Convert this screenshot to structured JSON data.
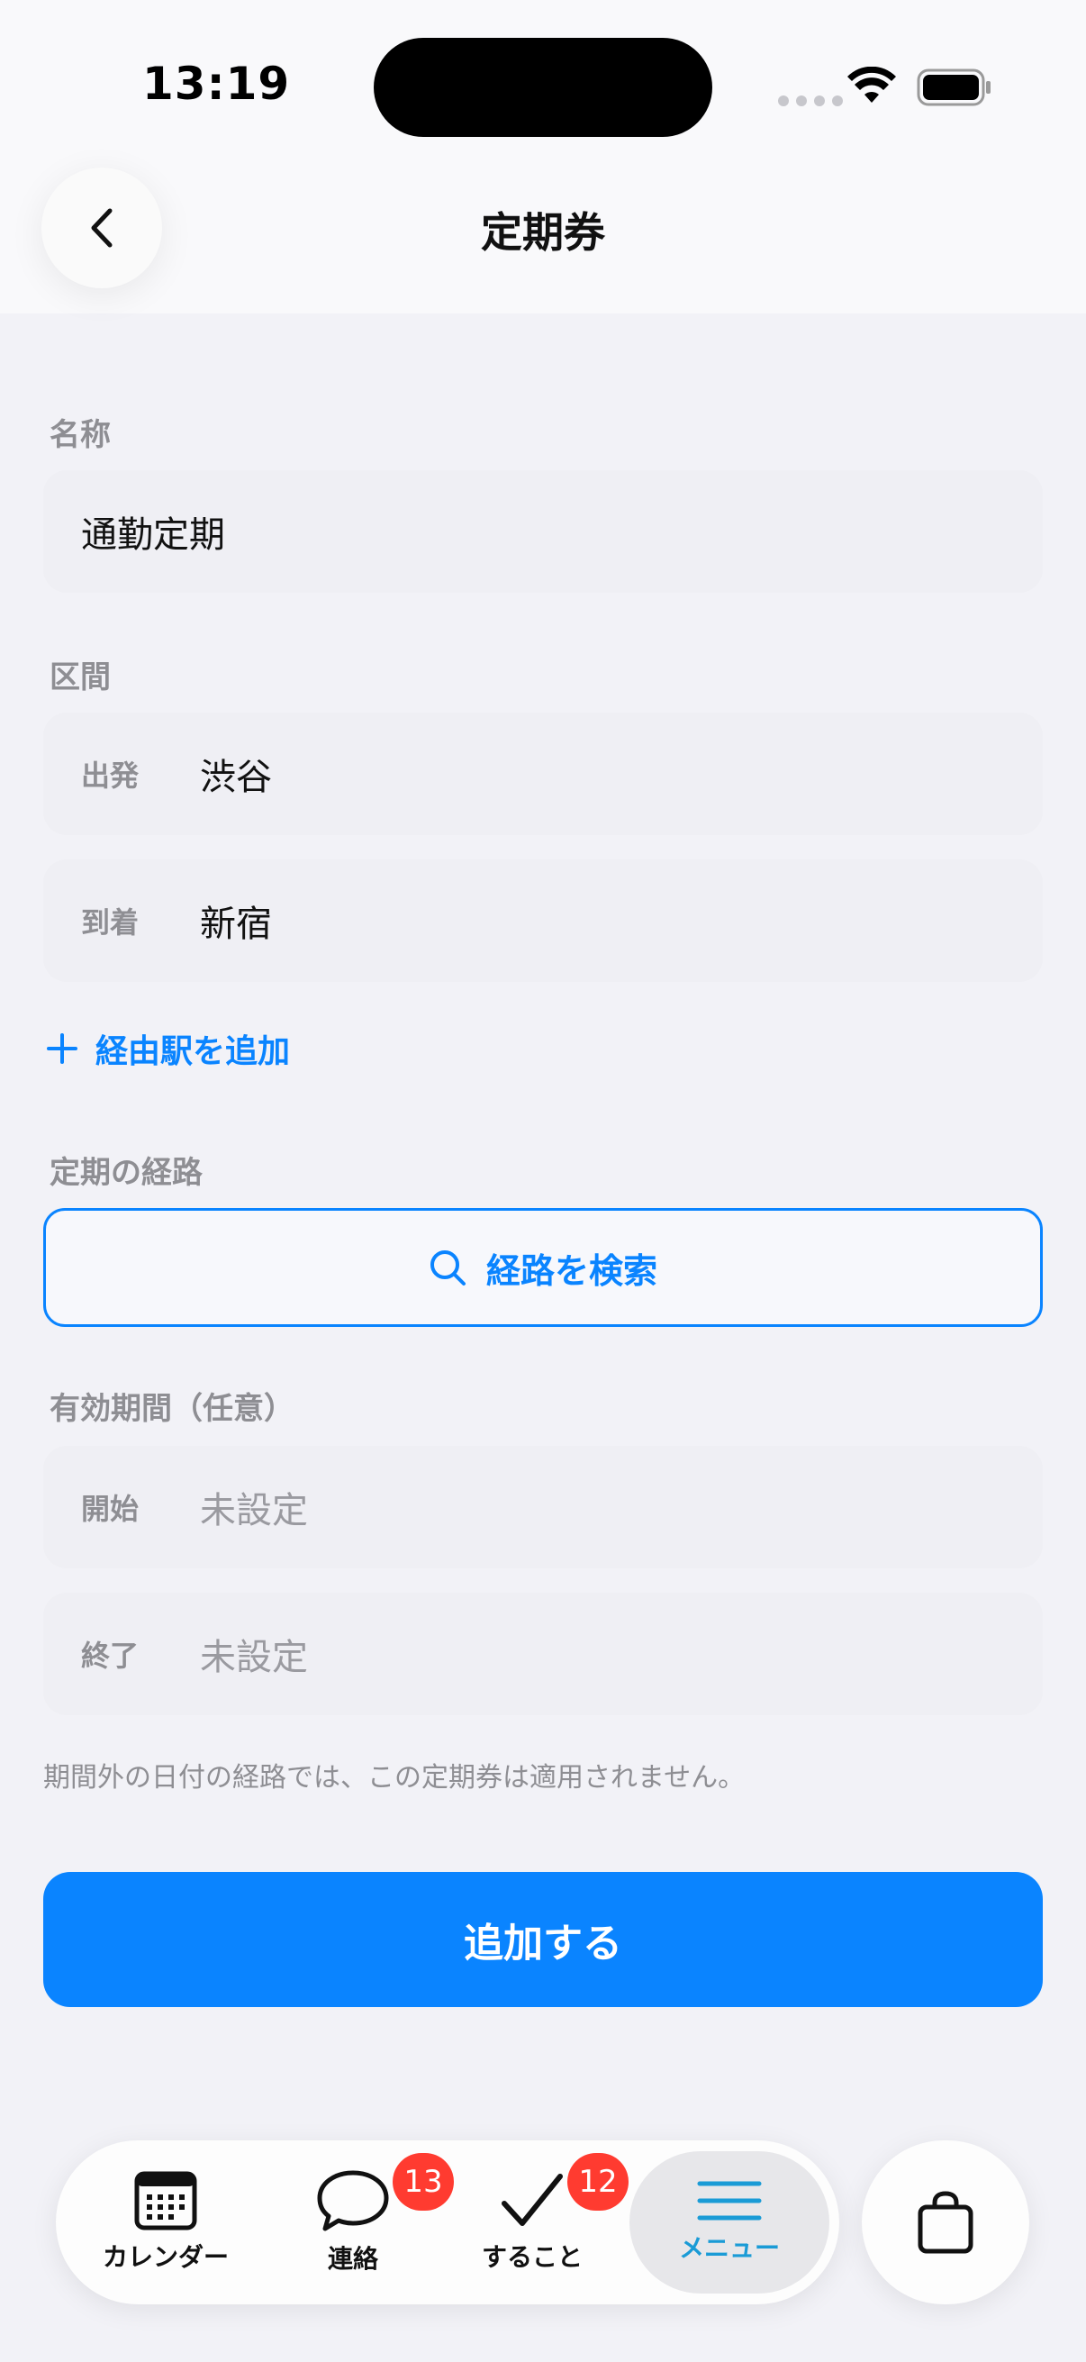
{
  "status_bar": {
    "time": "13:19"
  },
  "header": {
    "title": "定期券"
  },
  "form": {
    "name_label": "名称",
    "name_value": "通勤定期",
    "section_label": "区間",
    "departure_label": "出発",
    "departure_value": "渋谷",
    "arrival_label": "到着",
    "arrival_value": "新宿",
    "add_via_label": "経由駅を追加",
    "route_label": "定期の経路",
    "route_search_label": "経路を検索",
    "validity_label": "有効期間（任意）",
    "start_label": "開始",
    "start_placeholder": "未設定",
    "end_label": "終了",
    "end_placeholder": "未設定",
    "note": "期間外の日付の経路では、この定期券は適用されません。",
    "submit_label": "追加する"
  },
  "tab_bar": {
    "items": [
      {
        "label": "カレンダー",
        "icon": "calendar-icon"
      },
      {
        "label": "連絡",
        "icon": "chat-bubble-icon",
        "badge": "13"
      },
      {
        "label": "すること",
        "icon": "checkmark-icon",
        "badge": "12"
      },
      {
        "label": "メニュー",
        "icon": "menu-icon",
        "active": true
      }
    ],
    "bag_icon": "shopping-bag-icon"
  },
  "colors": {
    "accent": "#0a84ff",
    "badge": "#ff3b30",
    "active_tab": "#1a9bd6"
  }
}
